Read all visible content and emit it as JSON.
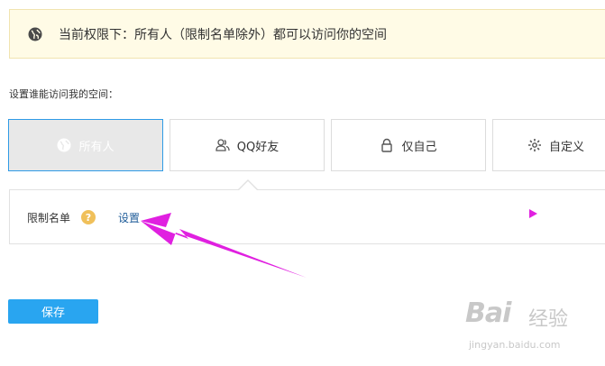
{
  "notice": {
    "text": "当前权限下：所有人（限制名单除外）都可以访问你的空间",
    "icon": "globe-icon"
  },
  "section": {
    "title": "设置谁能访问我的空间："
  },
  "tabs": [
    {
      "label": "所有人",
      "icon": "globe-icon",
      "active": true
    },
    {
      "label": "QQ好友",
      "icon": "friends-icon",
      "active": false
    },
    {
      "label": "仅自己",
      "icon": "lock-icon",
      "active": false
    },
    {
      "label": "自定义",
      "icon": "gear-icon",
      "active": false
    }
  ],
  "restrict": {
    "label": "限制名单",
    "help": "?",
    "link": "设置"
  },
  "save": {
    "label": "保存"
  },
  "watermark": {
    "brand": "Bai",
    "cn": "经验",
    "url": "jingyan.baidu.com"
  },
  "colors": {
    "accent": "#29a5f0",
    "notice_bg": "#fffbe6",
    "annotation": "#e020e0",
    "link": "#1f5c99"
  }
}
